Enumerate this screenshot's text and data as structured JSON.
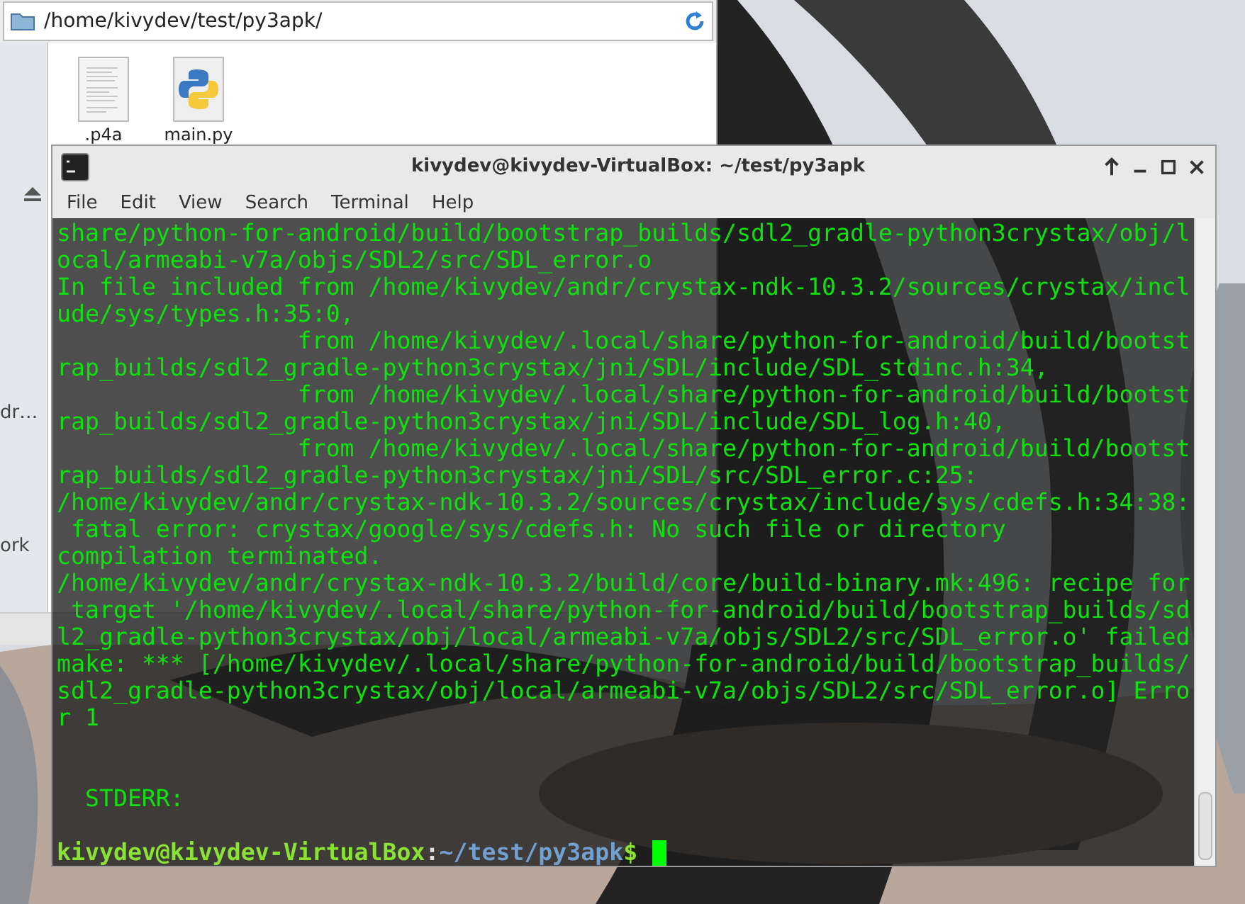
{
  "file_manager": {
    "path": "/home/kivydev/test/py3apk/",
    "sidebar": {
      "items": [
        {
          "label": "dr…"
        },
        {
          "label": "ork"
        }
      ]
    },
    "files": [
      {
        "name": ".p4a",
        "kind": "document"
      },
      {
        "name": "main.py",
        "kind": "python"
      }
    ]
  },
  "terminal": {
    "title": "kivydev@kivydev-VirtualBox: ~/test/py3apk",
    "menu": [
      "File",
      "Edit",
      "View",
      "Search",
      "Terminal",
      "Help"
    ],
    "output": [
      "share/python-for-android/build/bootstrap_builds/sdl2_gradle-python3crystax/obj/l",
      "ocal/armeabi-v7a/objs/SDL2/src/SDL_error.o",
      "In file included from /home/kivydev/andr/crystax-ndk-10.3.2/sources/crystax/incl",
      "ude/sys/types.h:35:0,",
      "                 from /home/kivydev/.local/share/python-for-android/build/bootst",
      "rap_builds/sdl2_gradle-python3crystax/jni/SDL/include/SDL_stdinc.h:34,",
      "                 from /home/kivydev/.local/share/python-for-android/build/bootst",
      "rap_builds/sdl2_gradle-python3crystax/jni/SDL/include/SDL_log.h:40,",
      "                 from /home/kivydev/.local/share/python-for-android/build/bootst",
      "rap_builds/sdl2_gradle-python3crystax/jni/SDL/src/SDL_error.c:25:",
      "/home/kivydev/andr/crystax-ndk-10.3.2/sources/crystax/include/sys/cdefs.h:34:38:",
      " fatal error: crystax/google/sys/cdefs.h: No such file or directory",
      "compilation terminated.",
      "/home/kivydev/andr/crystax-ndk-10.3.2/build/core/build-binary.mk:496: recipe for",
      " target '/home/kivydev/.local/share/python-for-android/build/bootstrap_builds/sd",
      "l2_gradle-python3crystax/obj/local/armeabi-v7a/objs/SDL2/src/SDL_error.o' failed",
      "make: *** [/home/kivydev/.local/share/python-for-android/build/bootstrap_builds/",
      "sdl2_gradle-python3crystax/obj/local/armeabi-v7a/objs/SDL2/src/SDL_error.o] Erro",
      "r 1"
    ],
    "stderr_label": "STDERR:",
    "prompt": {
      "user_host": "kivydev@kivydev-VirtualBox",
      "separator": ":",
      "path": "~/test/py3apk",
      "symbol": "$"
    }
  }
}
